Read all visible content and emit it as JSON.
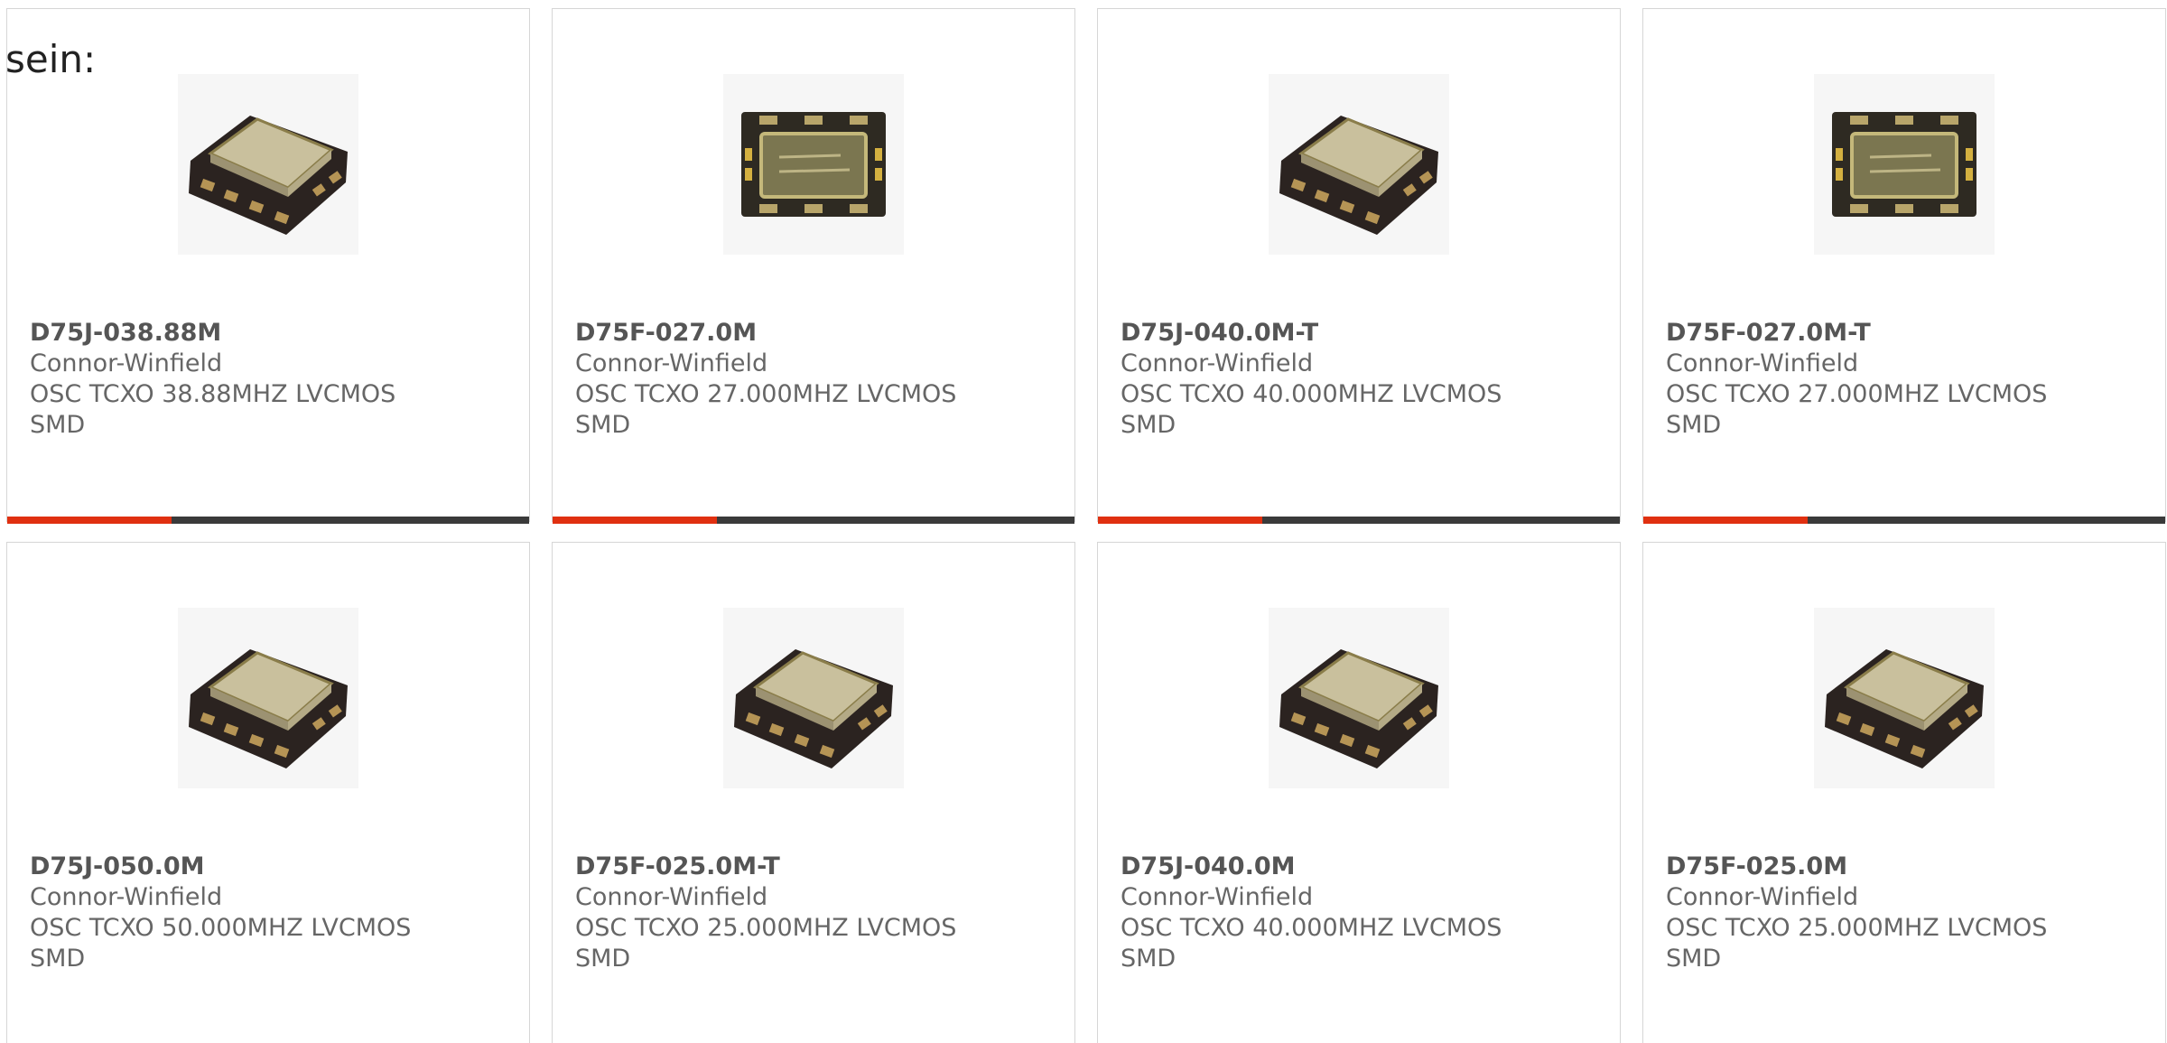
{
  "intro_text": "sein:",
  "colors": {
    "accent": "#e03010",
    "bar": "#3a3a3a",
    "border": "#d6d6d6"
  },
  "products": [
    {
      "part": "D75J-038.88M",
      "maker": "Connor-Winfield",
      "desc": "OSC TCXO 38.88MHZ LVCMOS",
      "pkg": "SMD",
      "image": "tcxo-angled-icon"
    },
    {
      "part": "D75F-027.0M",
      "maker": "Connor-Winfield",
      "desc": "OSC TCXO 27.000MHZ LVCMOS",
      "pkg": "SMD",
      "image": "tcxo-top-icon"
    },
    {
      "part": "D75J-040.0M-T",
      "maker": "Connor-Winfield",
      "desc": "OSC TCXO 40.000MHZ LVCMOS",
      "pkg": "SMD",
      "image": "tcxo-angled-icon"
    },
    {
      "part": "D75F-027.0M-T",
      "maker": "Connor-Winfield",
      "desc": "OSC TCXO 27.000MHZ LVCMOS",
      "pkg": "SMD",
      "image": "tcxo-top-icon"
    },
    {
      "part": "D75J-050.0M",
      "maker": "Connor-Winfield",
      "desc": "OSC TCXO 50.000MHZ LVCMOS",
      "pkg": "SMD",
      "image": "tcxo-angled-icon"
    },
    {
      "part": "D75F-025.0M-T",
      "maker": "Connor-Winfield",
      "desc": "OSC TCXO 25.000MHZ LVCMOS",
      "pkg": "SMD",
      "image": "tcxo-angled-icon"
    },
    {
      "part": "D75J-040.0M",
      "maker": "Connor-Winfield",
      "desc": "OSC TCXO 40.000MHZ LVCMOS",
      "pkg": "SMD",
      "image": "tcxo-angled-icon"
    },
    {
      "part": "D75F-025.0M",
      "maker": "Connor-Winfield",
      "desc": "OSC TCXO 25.000MHZ LVCMOS",
      "pkg": "SMD",
      "image": "tcxo-angled-icon"
    }
  ]
}
